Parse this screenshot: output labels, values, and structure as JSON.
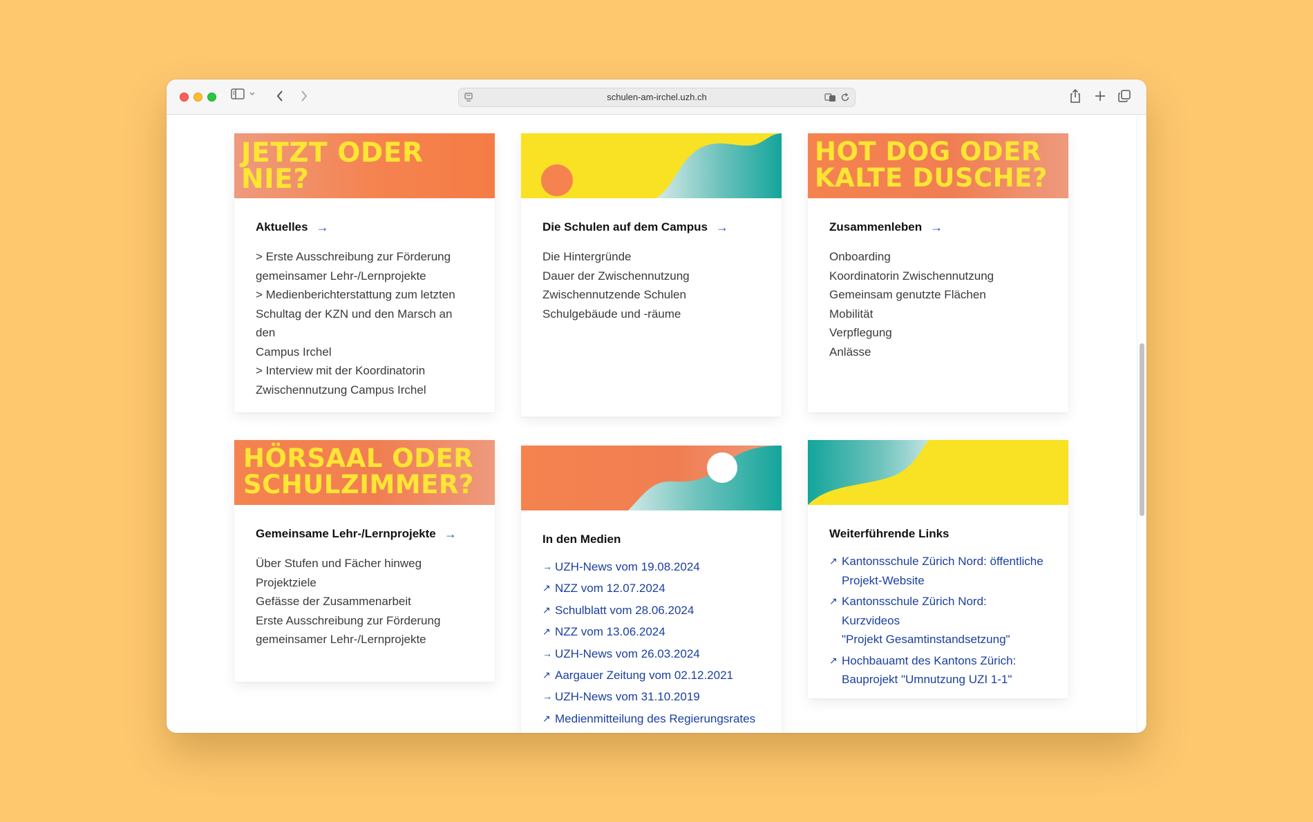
{
  "browser": {
    "url": "schulen-am-irchel.uzh.ch"
  },
  "colors": {
    "orange": "#f5834f",
    "salmon": "#ee9a7d",
    "yellow_text": "#ffe534",
    "yellow_bg": "#f9e223",
    "teal": "#13a59b",
    "link": "#1a3fa0"
  },
  "cards": {
    "aktuelles": {
      "banner": [
        "JETZT ODER NIE?"
      ],
      "title": "Aktuelles",
      "arrow": "→",
      "items": [
        "> Erste Ausschreibung zur Förderung",
        "gemeinsamer Lehr-/Lernprojekte",
        "> Medienberichterstattung zum letzten",
        "Schultag der KZN und den Marsch an den",
        "Campus Irchel",
        "> Interview mit der Koordinatorin",
        "Zwischennutzung Campus Irchel"
      ]
    },
    "schulen": {
      "title": "Die Schulen auf dem Campus",
      "arrow": "→",
      "items": [
        "Die Hintergründe",
        "Dauer der Zwischennutzung",
        "Zwischennutzende Schulen",
        "Schulgebäude und -räume"
      ]
    },
    "zusammenleben": {
      "banner": [
        "HOT DOG ODER",
        "KALTE DUSCHE?"
      ],
      "title": "Zusammenleben",
      "arrow": "→",
      "items": [
        "Onboarding",
        "Koordinatorin Zwischennutzung",
        "Gemeinsam genutzte Flächen",
        "Mobilität",
        "Verpflegung",
        "Anlässe"
      ]
    },
    "projekte": {
      "banner": [
        "HÖRSAAL ODER",
        "SCHULZIMMER?"
      ],
      "title": "Gemeinsame Lehr-/Lernprojekte",
      "arrow": "→",
      "items": [
        "Über Stufen und Fächer hinweg",
        "Projektziele",
        "Gefässe der Zusammenarbeit",
        "Erste Ausschreibung zur Förderung",
        "gemeinsamer Lehr-/Lernprojekte"
      ]
    },
    "medien": {
      "title": "In den Medien",
      "links": [
        {
          "icon": "arrow-right-icon",
          "glyph": "→",
          "label": "UZH-News vom 19.08.2024"
        },
        {
          "icon": "external-link-icon",
          "glyph": "↗",
          "label": "NZZ vom 12.07.2024"
        },
        {
          "icon": "external-link-icon",
          "glyph": "↗",
          "label": "Schulblatt vom 28.06.2024"
        },
        {
          "icon": "external-link-icon",
          "glyph": "↗",
          "label": "NZZ vom 13.06.2024"
        },
        {
          "icon": "arrow-right-icon",
          "glyph": "→",
          "label": "UZH-News vom 26.03.2024"
        },
        {
          "icon": "external-link-icon",
          "glyph": "↗",
          "label": "Aargauer Zeitung vom 02.12.2021"
        },
        {
          "icon": "arrow-right-icon",
          "glyph": "→",
          "label": "UZH-News vom 31.10.2019"
        },
        {
          "icon": "external-link-icon",
          "glyph": "↗",
          "label": "Medienmitteilung des Regierungsrates"
        }
      ]
    },
    "weiterfuehrend": {
      "title": "Weiterführende Links",
      "links": [
        {
          "icon": "external-link-icon",
          "glyph": "↗",
          "lines": [
            "Kantonsschule Zürich Nord: öffentliche",
            "Projekt-Website"
          ]
        },
        {
          "icon": "external-link-icon",
          "glyph": "↗",
          "lines": [
            "Kantonsschule Zürich Nord: Kurzvideos",
            "\"Projekt Gesamtinstandsetzung\""
          ]
        },
        {
          "icon": "external-link-icon",
          "glyph": "↗",
          "lines": [
            "Hochbauamt des Kantons Zürich:",
            "Bauprojekt \"Umnutzung UZI 1-1\""
          ]
        }
      ]
    }
  }
}
